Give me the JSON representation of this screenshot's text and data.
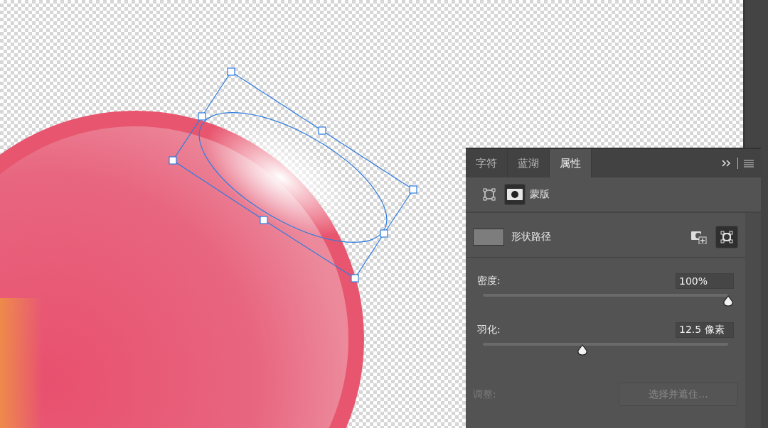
{
  "panel": {
    "tabs": [
      {
        "label": "字符",
        "selected": false
      },
      {
        "label": "蓝湖",
        "selected": false
      },
      {
        "label": "属性",
        "selected": true
      }
    ],
    "mask_modes": [
      {
        "kind": "vector",
        "selected": false
      },
      {
        "kind": "pixel",
        "selected": true
      }
    ],
    "mask_label": "蒙版",
    "path_label": "形状路径",
    "sliders": [
      {
        "label": "密度:",
        "value": "100%",
        "level": 1
      },
      {
        "label": "羽化:",
        "value": "12.5 像素",
        "level": 0.405
      }
    ],
    "adjust": {
      "label": "调整:",
      "button": "选择并遮住...",
      "disabled": true
    }
  }
}
